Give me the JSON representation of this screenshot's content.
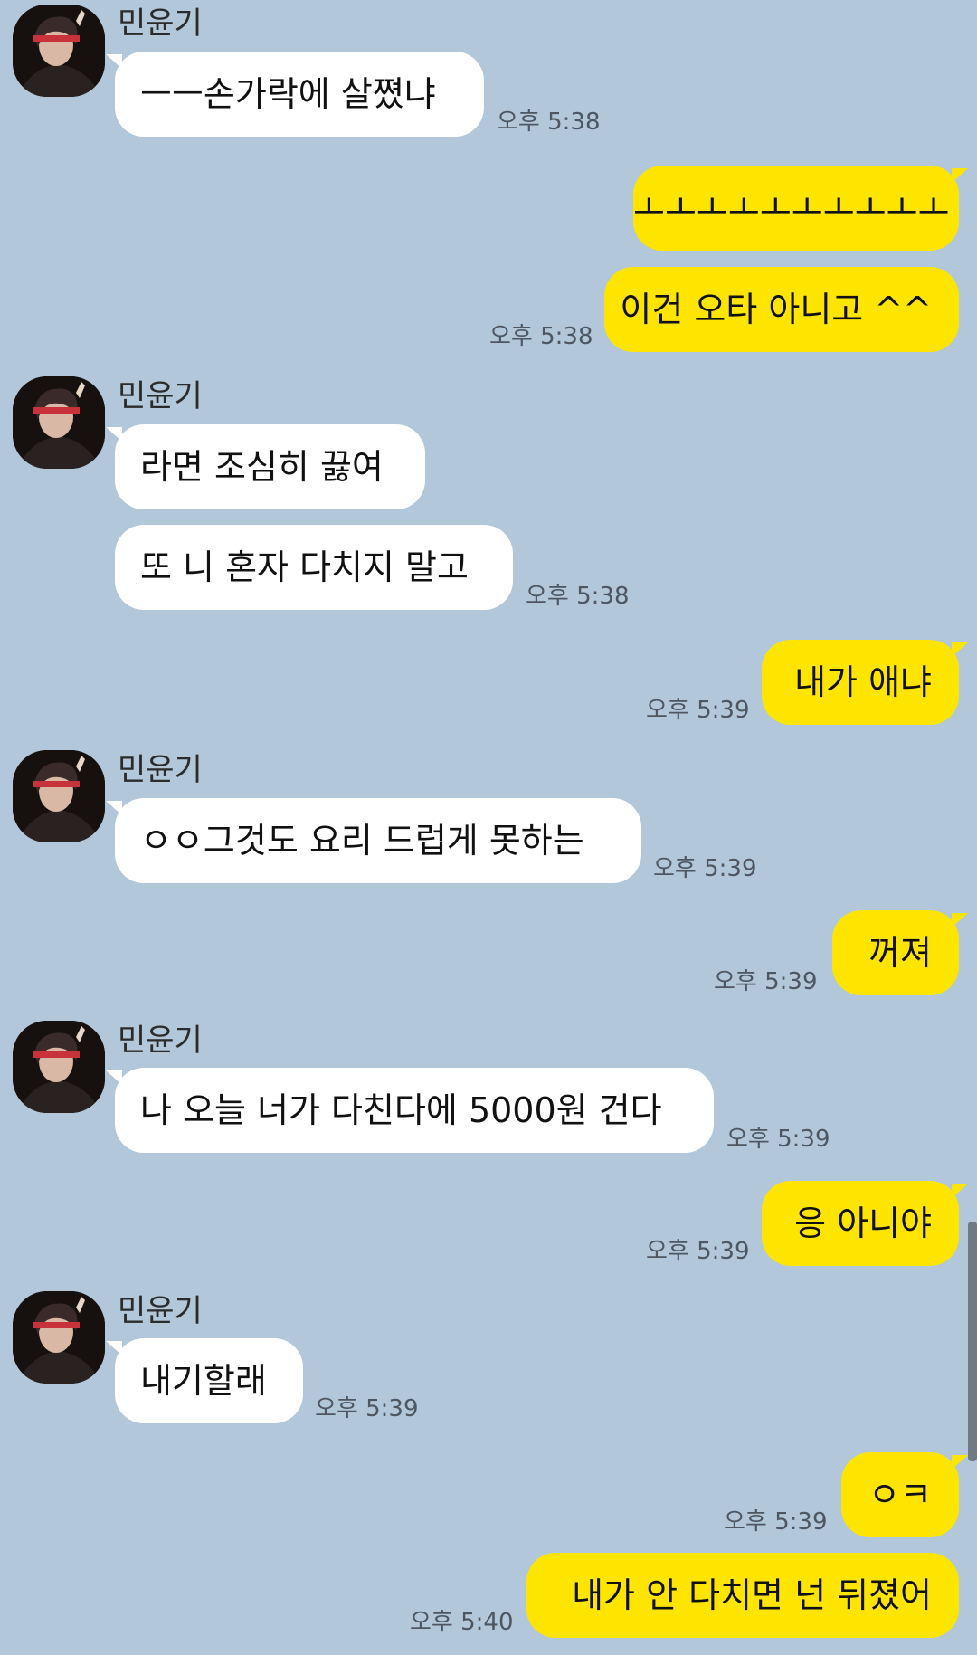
{
  "chat": {
    "sender_name": "민윤기",
    "messages": [
      {
        "side": "in",
        "text": "ㅡㅡ손가락에 살쪘냐",
        "time": "오후 5:38"
      },
      {
        "side": "out",
        "text": "ㅗㅗㅗㅗㅗㅗㅗㅗㅗㅗ",
        "time": ""
      },
      {
        "side": "out",
        "text": "이건 오타 아니고 ^^",
        "time": "오후 5:38"
      },
      {
        "side": "in",
        "text": "라면 조심히 끓여",
        "time": ""
      },
      {
        "side": "in",
        "text": "또 니 혼자 다치지 말고",
        "time": "오후 5:38"
      },
      {
        "side": "out",
        "text": "내가 애냐",
        "time": "오후 5:39"
      },
      {
        "side": "in",
        "text": "ㅇㅇ그것도 요리 드럽게 못하는",
        "time": "오후 5:39"
      },
      {
        "side": "out",
        "text": "꺼져",
        "time": "오후 5:39"
      },
      {
        "side": "in",
        "text": "나 오늘 너가 다친다에 5000원 건다",
        "time": "오후 5:39"
      },
      {
        "side": "out",
        "text": "응 아니야",
        "time": "오후 5:39"
      },
      {
        "side": "in",
        "text": "내기할래",
        "time": "오후 5:39"
      },
      {
        "side": "out",
        "text": "ㅇㅋ",
        "time": "오후 5:39"
      },
      {
        "side": "out",
        "text": "내가 안 다치면 넌 뒤졌어",
        "time": "오후 5:40"
      }
    ]
  },
  "colors": {
    "background": "#b2c7da",
    "incoming_bubble": "#ffffff",
    "outgoing_bubble": "#fee500"
  }
}
